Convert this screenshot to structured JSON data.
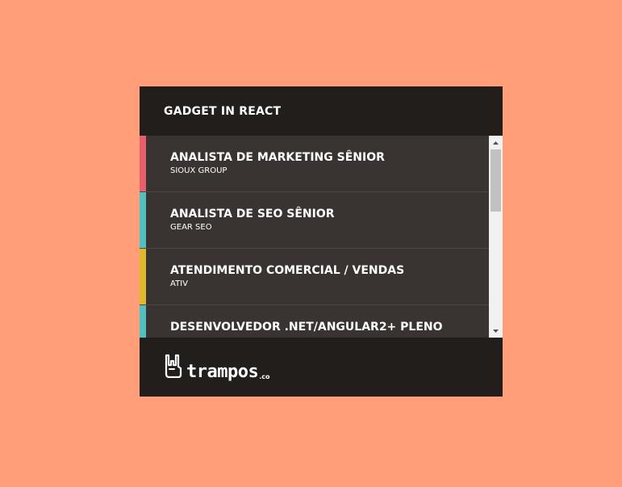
{
  "header": {
    "title": "GADGET IN REACT"
  },
  "jobs": [
    {
      "title": "ANALISTA DE MARKETING SÊNIOR",
      "company": "SIOUX GROUP",
      "color": "#e85e6c"
    },
    {
      "title": "ANALISTA DE SEO SÊNIOR",
      "company": "GEAR SEO",
      "color": "#4fc1c0"
    },
    {
      "title": "ATENDIMENTO COMERCIAL / VENDAS",
      "company": "ATIV",
      "color": "#e0b92a"
    },
    {
      "title": "DESENVOLVEDOR .NET/ANGULAR2+ PLENO",
      "company": "",
      "color": "#4fc1c0"
    }
  ],
  "footer": {
    "logo_text": "trampos",
    "logo_suffix": ".co",
    "logo_icon": "rock-hand-icon"
  },
  "colors": {
    "background": "#FF9E79",
    "panel": "#221e1c",
    "list_bg": "#393431"
  }
}
